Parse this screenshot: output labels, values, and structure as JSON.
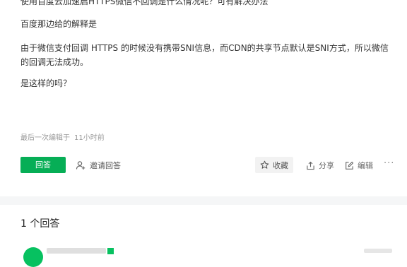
{
  "question": {
    "lines": [
      "使用百度云加速启HTTPS微信不回调是什么情况呢？可有解决办法",
      "百度那边给的解释是",
      "由于微信支付回调 HTTPS 的时候没有携带SNI信息，而CDN的共享节点默认是SNI方式，所以微信的回调无法成功。",
      "是这样的吗？"
    ],
    "edit_label": "最后一次编辑于",
    "edit_time": "11小时前"
  },
  "actions": {
    "answer": "回答",
    "invite": "邀请回答",
    "favorite": "收藏",
    "share": "分享",
    "edit": "编辑",
    "more": "···"
  },
  "answers": {
    "title": "1 个回答"
  },
  "colors": {
    "primary": "#06ae56",
    "page_gap": "#f5f6f7",
    "muted": "#999999"
  },
  "icons": {
    "invite": "add-user-icon",
    "favorite": "star-icon",
    "share": "share-icon",
    "edit": "edit-icon"
  }
}
